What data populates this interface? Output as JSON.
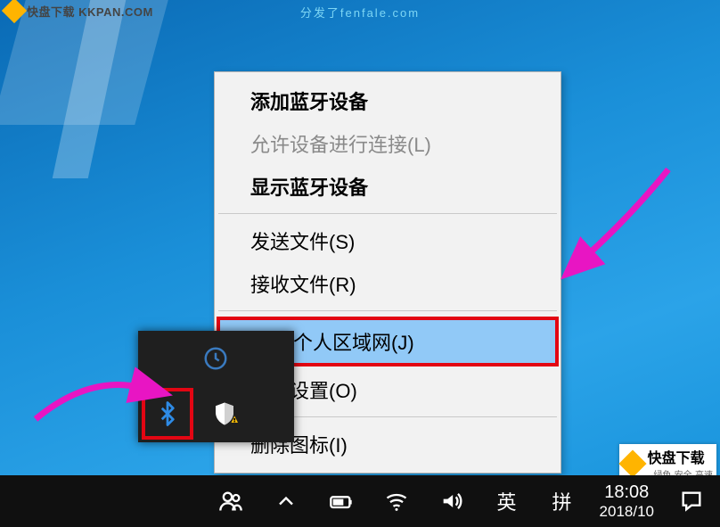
{
  "watermarks": {
    "top_left_brand": "快盘下载",
    "top_left_domain": "KKPAN.COM",
    "center_text": "分发了fenfale.com",
    "bottom_right_brand": "快盘下载",
    "bottom_right_tag": "··绿色·安全·高速"
  },
  "context_menu": {
    "items": [
      {
        "label": "添加蓝牙设备",
        "bold": true,
        "disabled": false
      },
      {
        "label": "允许设备进行连接(L)",
        "bold": false,
        "disabled": true
      },
      {
        "label": "显示蓝牙设备",
        "bold": true,
        "disabled": false
      }
    ],
    "items2": [
      {
        "label": "发送文件(S)"
      },
      {
        "label": "接收文件(R)"
      }
    ],
    "highlighted": {
      "label": "加入个人区域网(J)"
    },
    "items3": [
      {
        "label": "打开设置(O)"
      }
    ],
    "items4": [
      {
        "label": "删除图标(I)"
      }
    ]
  },
  "tray_icons": {
    "clock": "clock-icon",
    "bluetooth": "bluetooth-icon",
    "shield": "defender-shield-icon"
  },
  "taskbar": {
    "people": "people-icon",
    "chevron": "tray-chevron-icon",
    "battery": "battery-icon",
    "wifi": "wifi-icon",
    "volume": "volume-icon",
    "ime1": "英",
    "ime2": "拼",
    "time": "18:08",
    "date": "2018/10",
    "notifications": "action-center-icon"
  }
}
